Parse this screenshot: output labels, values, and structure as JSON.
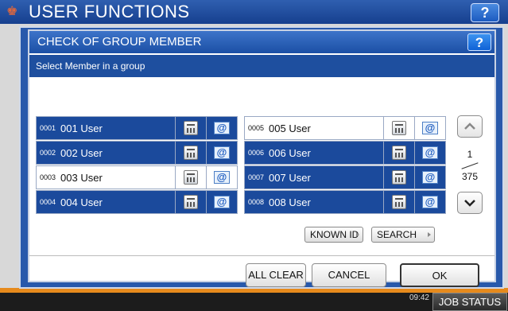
{
  "app": {
    "title": "USER FUNCTIONS",
    "help_label": "?",
    "time": "09:42",
    "job_status_label": "JOB STATUS"
  },
  "dialog": {
    "title": "CHECK OF GROUP MEMBER",
    "help_label": "?",
    "subtitle": "Select Member in a group",
    "members_left": [
      {
        "id": "0001",
        "name": "001 User",
        "selected": false
      },
      {
        "id": "0002",
        "name": "002 User",
        "selected": false
      },
      {
        "id": "0003",
        "name": "003 User",
        "selected": true
      },
      {
        "id": "0004",
        "name": "004 User",
        "selected": false
      }
    ],
    "members_right": [
      {
        "id": "0005",
        "name": "005 User",
        "selected": true
      },
      {
        "id": "0006",
        "name": "006 User",
        "selected": false
      },
      {
        "id": "0007",
        "name": "007 User",
        "selected": false
      },
      {
        "id": "0008",
        "name": "008 User",
        "selected": false
      }
    ],
    "mail_glyph": "@",
    "pager": {
      "current": "1",
      "total": "375"
    },
    "known_id_label": "KNOWN ID",
    "search_label": "SEARCH",
    "all_clear_label": "ALL CLEAR",
    "cancel_label": "CANCEL",
    "ok_label": "OK"
  }
}
